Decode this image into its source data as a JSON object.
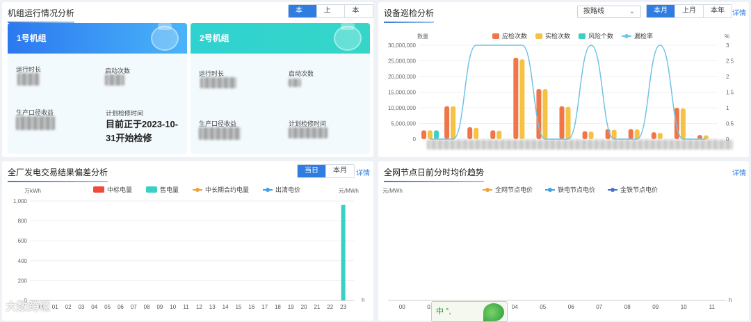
{
  "unit_panel": {
    "title": "机组运行情况分析",
    "tabs": [
      "本月",
      "上月",
      "本年"
    ],
    "units": [
      {
        "name": "1号机组",
        "run_time_label": "运行时长",
        "start_count_label": "启动次数",
        "gen_label": "生产口径收益",
        "plan_label": "计划检修时间",
        "plan_text": "目前正于2023-10-31开始检修"
      },
      {
        "name": "2号机组",
        "run_time_label": "运行时长",
        "start_count_label": "启动次数",
        "gen_label": "生产口径收益",
        "plan_label": "计划检修时间"
      }
    ]
  },
  "inspection_panel": {
    "title": "设备巡检分析",
    "select_value": "按路线",
    "tabs": [
      "本月",
      "上月",
      "本年"
    ],
    "detail": "详情",
    "chart_data": {
      "type": "bar",
      "ylabel": "数量",
      "y2label": "%",
      "ylim": [
        0,
        30000000
      ],
      "y2lim": [
        0,
        3
      ],
      "yticks": [
        "30,000,000",
        "25,000,000",
        "20,000,000",
        "15,000,000",
        "10,000,000",
        "5,000,000",
        "0"
      ],
      "y2ticks": [
        "3",
        "2.5",
        "2",
        "1.5",
        "1",
        "0.5",
        "0"
      ],
      "series": [
        {
          "name": "应检次数",
          "color": "#f0764a",
          "values": [
            2800000,
            10500000,
            3800000,
            2800000,
            26000000,
            16000000,
            10500000,
            2500000,
            3200000,
            3200000,
            2200000,
            10000000,
            1300000
          ]
        },
        {
          "name": "实检次数",
          "color": "#f6c244",
          "values": [
            2800000,
            10500000,
            3600000,
            2700000,
            25500000,
            16000000,
            10300000,
            2400000,
            3000000,
            3100000,
            2000000,
            9800000,
            1200000
          ]
        },
        {
          "name": "风险个数",
          "color": "#3ccfc4",
          "values": [
            2800000,
            0,
            0,
            0,
            0,
            0,
            0,
            0,
            0,
            0,
            0,
            0,
            0
          ]
        },
        {
          "name": "漏检率",
          "color": "#6ec3e6",
          "values": [
            0,
            0,
            3,
            3,
            3,
            0,
            0,
            3,
            0,
            0,
            3,
            0,
            0
          ]
        }
      ]
    }
  },
  "trade_panel": {
    "title": "全厂发电交易结果偏差分析",
    "tabs": [
      "当日",
      "本月"
    ],
    "detail": "详情",
    "chart_data": {
      "type": "bar",
      "ylabel": "万kWh",
      "y2label": "元/MWh",
      "xlabel": "h",
      "ylim": [
        0,
        1000
      ],
      "yticks": [
        "1,000",
        "800",
        "600",
        "400",
        "200",
        "0"
      ],
      "categories": [
        "00",
        "01",
        "02",
        "03",
        "04",
        "05",
        "06",
        "07",
        "08",
        "09",
        "10",
        "11",
        "12",
        "13",
        "14",
        "15",
        "16",
        "17",
        "18",
        "19",
        "20",
        "21",
        "22",
        "23"
      ],
      "series": [
        {
          "name": "中标电量",
          "color": "#f04a3a",
          "values": []
        },
        {
          "name": "售电量",
          "color": "#3ccfc4",
          "values": [
            0,
            0,
            0,
            0,
            0,
            0,
            0,
            0,
            0,
            0,
            0,
            0,
            0,
            0,
            0,
            0,
            0,
            0,
            0,
            0,
            0,
            0,
            0,
            960
          ]
        },
        {
          "name": "中长期合约电量",
          "color": "#f5a033",
          "values": []
        },
        {
          "name": "出清电价",
          "color": "#3aa0ea",
          "values": []
        }
      ]
    }
  },
  "node_panel": {
    "title": "全网节点日前分时均价趋势",
    "detail": "详情",
    "chart_data": {
      "type": "line",
      "ylabel": "元/MWh",
      "xlabel": "h",
      "categories": [
        "00",
        "01",
        "02",
        "03",
        "04",
        "05",
        "06",
        "07",
        "08",
        "09",
        "10",
        "11"
      ],
      "series": [
        {
          "name": "全网节点电价",
          "color": "#f5a033",
          "values": []
        },
        {
          "name": "铁电节点电价",
          "color": "#3aa0ea",
          "values": []
        },
        {
          "name": "金铁节点电价",
          "color": "#4a6fc6",
          "values": []
        }
      ]
    }
  },
  "overlay": {
    "watermark": "大数跨境",
    "ime": "中 °,"
  }
}
